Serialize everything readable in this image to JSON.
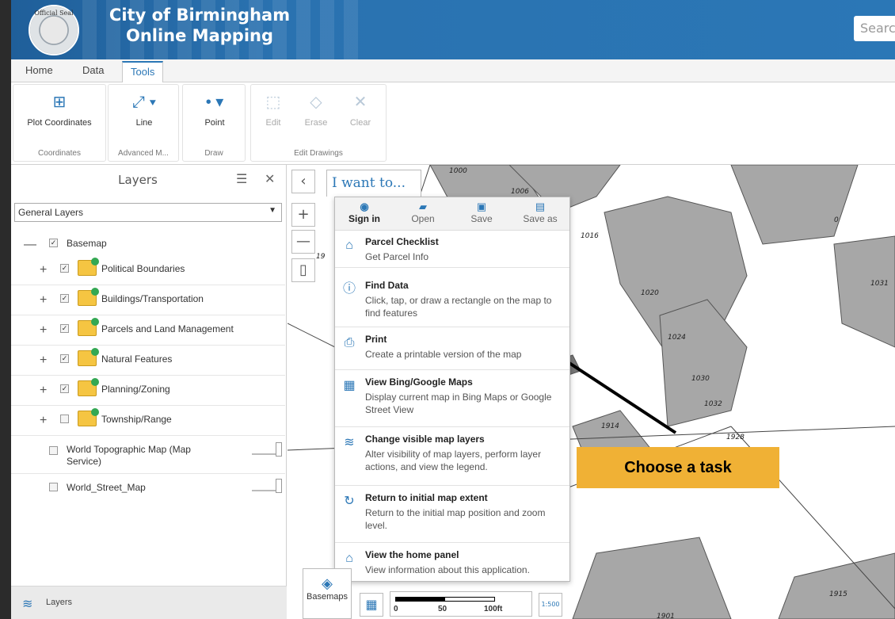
{
  "header": {
    "title_line1": "City of Birmingham",
    "title_line2": "Online Mapping",
    "seal_text": "Official Seal",
    "search_placeholder": "Searc"
  },
  "tabs": [
    "Home",
    "Data",
    "Tools"
  ],
  "ribbon": {
    "groups": [
      {
        "label": "Coordinates",
        "tools": [
          {
            "label": "Plot Coordinates",
            "icon": "plot-coordinates-icon"
          }
        ]
      },
      {
        "label": "Advanced M...",
        "tools": [
          {
            "label": "Line",
            "icon": "line-measure-icon"
          }
        ]
      },
      {
        "label": "Draw",
        "tools": [
          {
            "label": "Point",
            "icon": "point-icon"
          }
        ]
      },
      {
        "label": "Edit Drawings",
        "tools": [
          {
            "label": "Edit",
            "icon": "edit-icon"
          },
          {
            "label": "Erase",
            "icon": "eraser-icon"
          },
          {
            "label": "Clear",
            "icon": "clear-icon"
          }
        ]
      }
    ]
  },
  "layers": {
    "title": "Layers",
    "select_value": "General Layers",
    "basemap_label": "Basemap",
    "items": [
      "Political Boundaries",
      "Buildings/Transportation",
      "Parcels and Land Management",
      "Natural Features",
      "Planning/Zoning",
      "Township/Range"
    ],
    "services": [
      "World Topographic Map (Map Service)",
      "World_Street_Map"
    ],
    "footer_label": "Layers"
  },
  "iwant": {
    "tab_label": "I want to...",
    "tools": [
      "Sign in",
      "Open",
      "Save",
      "Save as"
    ],
    "tasks": [
      {
        "title": "Parcel Checklist",
        "desc": "Get Parcel Info"
      },
      {
        "title": "Find Data",
        "desc": "Click, tap, or draw a rectangle on the map to find features"
      },
      {
        "title": "Print",
        "desc": "Create a printable version of the map"
      },
      {
        "title": "View Bing/Google Maps",
        "desc": "Display current map in Bing Maps or Google Street View"
      },
      {
        "title": "Change visible map layers",
        "desc": "Alter visibility of map layers, perform layer actions, and view the legend."
      },
      {
        "title": "Return to initial map extent",
        "desc": "Return to the initial map position and zoom level."
      },
      {
        "title": "View the home panel",
        "desc": "View information about this application."
      }
    ]
  },
  "annotation": "Choose a task",
  "map": {
    "basemaps_label": "Basemaps",
    "scale_labels": [
      "0",
      "50",
      "100ft"
    ],
    "scale_ratio": "1:500",
    "parcels": [
      "1000",
      "1006",
      "1016",
      "0",
      "1020",
      "1031",
      "1024",
      "1030",
      "1032",
      "1914",
      "1928",
      "1915",
      "1901",
      "19"
    ]
  }
}
